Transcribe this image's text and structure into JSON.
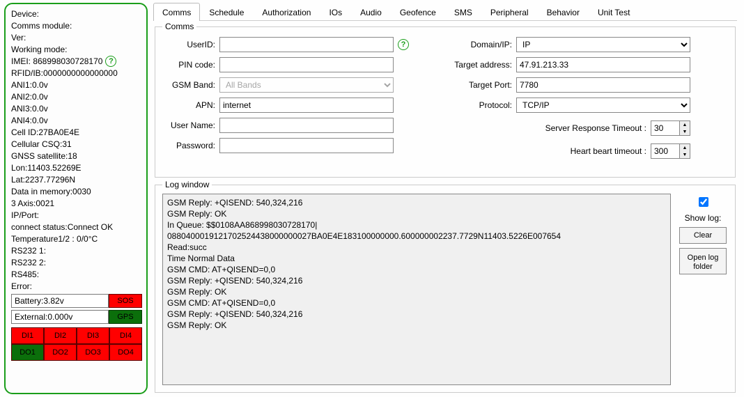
{
  "left": {
    "device_label": "Device:",
    "comms_module_label": "Comms module:",
    "ver_label": "Ver:",
    "working_mode_label": "Working mode:",
    "imei": "IMEI:  868998030728170",
    "help_glyph": "?",
    "rfid": "RFID/IB:0000000000000000",
    "ani1": "ANI1:0.0v",
    "ani2": "ANI2:0.0v",
    "ani3": "ANI3:0.0v",
    "ani4": "ANI4:0.0v",
    "cellid": "Cell ID:27BA0E4E",
    "csq": "Cellular CSQ:31",
    "gnss": "GNSS satellite:18",
    "lon": "Lon:11403.52269E",
    "lat": "Lat:2237.77296N",
    "datamem": "Data in memory:0030",
    "axis": "3 Axis:0021",
    "ipport": "IP/Port:",
    "conn": "connect status:Connect OK",
    "temp": "Temperature1/2 : 0/0°C",
    "rs2321": "RS232 1:",
    "rs2322": "RS232 2:",
    "rs485": "RS485:",
    "error": "Error:",
    "battery": "Battery:3.82v",
    "sos": "SOS",
    "external": "External:0.000v",
    "gps": "GPS",
    "di": [
      "DI1",
      "DI2",
      "DI3",
      "DI4"
    ],
    "do": [
      "DO1",
      "DO2",
      "DO3",
      "DO4"
    ]
  },
  "tabs": [
    "Comms",
    "Schedule",
    "Authorization",
    "IOs",
    "Audio",
    "Geofence",
    "SMS",
    "Peripheral",
    "Behavior",
    "Unit Test"
  ],
  "comms": {
    "section_title": "Comms",
    "userid_label": "UserID:",
    "userid": "",
    "pin_label": "PIN code:",
    "pin": "",
    "gsmband_label": "GSM Band:",
    "gsmband": "All Bands",
    "apn_label": "APN:",
    "apn": "internet",
    "username_label": "User Name:",
    "username": "",
    "password_label": "Password:",
    "password": "",
    "domain_label": "Domain/IP:",
    "domain": "IP",
    "target_addr_label": "Target address:",
    "target_addr": "47.91.213.33",
    "target_port_label": "Target Port:",
    "target_port": "7780",
    "protocol_label": "Protocol:",
    "protocol": "TCP/IP",
    "srv_timeout_label": "Server Response Timeout :",
    "srv_timeout": "30",
    "heartbeat_label": "Heart beart timeout :",
    "heartbeat": "300",
    "help_glyph": "?"
  },
  "log": {
    "title": "Log window",
    "text": "GSM Reply: +QISEND: 540,324,216\nGSM Reply: OK\nIn Queue: $$0108AA868998030728170|\n0880400019121702524438000000027BA0E4E183100000000.600000002237.7729N11403.5226E007654\nRead:succ\nTime Normal Data\nGSM CMD: AT+QISEND=0,0\nGSM Reply: +QISEND: 540,324,216\nGSM Reply: OK\nGSM CMD: AT+QISEND=0,0\nGSM Reply: +QISEND: 540,324,216\nGSM Reply: OK",
    "showlog_label": "Show log:",
    "clear": "Clear",
    "openfolder": "Open log folder"
  }
}
